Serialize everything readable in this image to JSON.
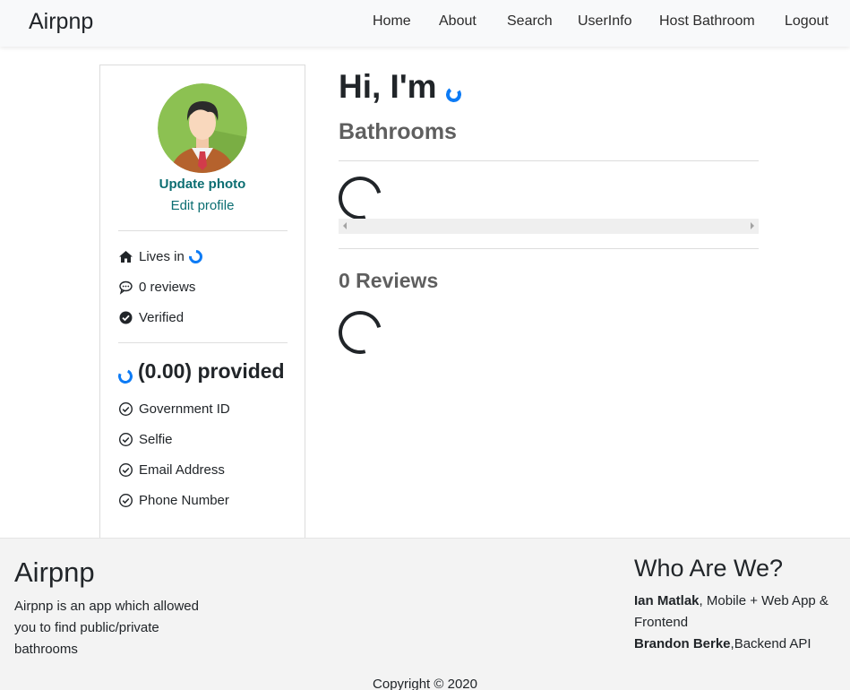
{
  "navbar": {
    "brand": "Airpnp",
    "links": [
      "Home",
      "About",
      "Search",
      "UserInfo",
      "Host Bathroom",
      "Logout"
    ]
  },
  "profile": {
    "update_photo": "Update photo",
    "edit_profile": "Edit profile",
    "lives_in": "Lives in",
    "reviews": "0 reviews",
    "verified": "Verified",
    "provided_title": "(0.00) provided",
    "provided_items": [
      "Government ID",
      "Selfie",
      "Email Address",
      "Phone Number"
    ]
  },
  "main": {
    "greeting": "Hi, I'm",
    "bathrooms_title": "Bathrooms",
    "reviews_title": "0 Reviews"
  },
  "footer": {
    "title": "Airpnp",
    "description": "Airpnp is an app which allowed you to find public/private bathrooms",
    "who_title": "Who Are We?",
    "member1_name": "Ian Matlak",
    "member1_role": ", Mobile + Web App & Frontend",
    "member2_name": "Brandon Berke",
    "member2_role": ",Backend API",
    "copyright": "Copyright © 2020"
  },
  "colors": {
    "link_teal": "#0c6e72",
    "spinner_blue": "#0d7bf5",
    "footer_bg": "#f3f3f3"
  }
}
